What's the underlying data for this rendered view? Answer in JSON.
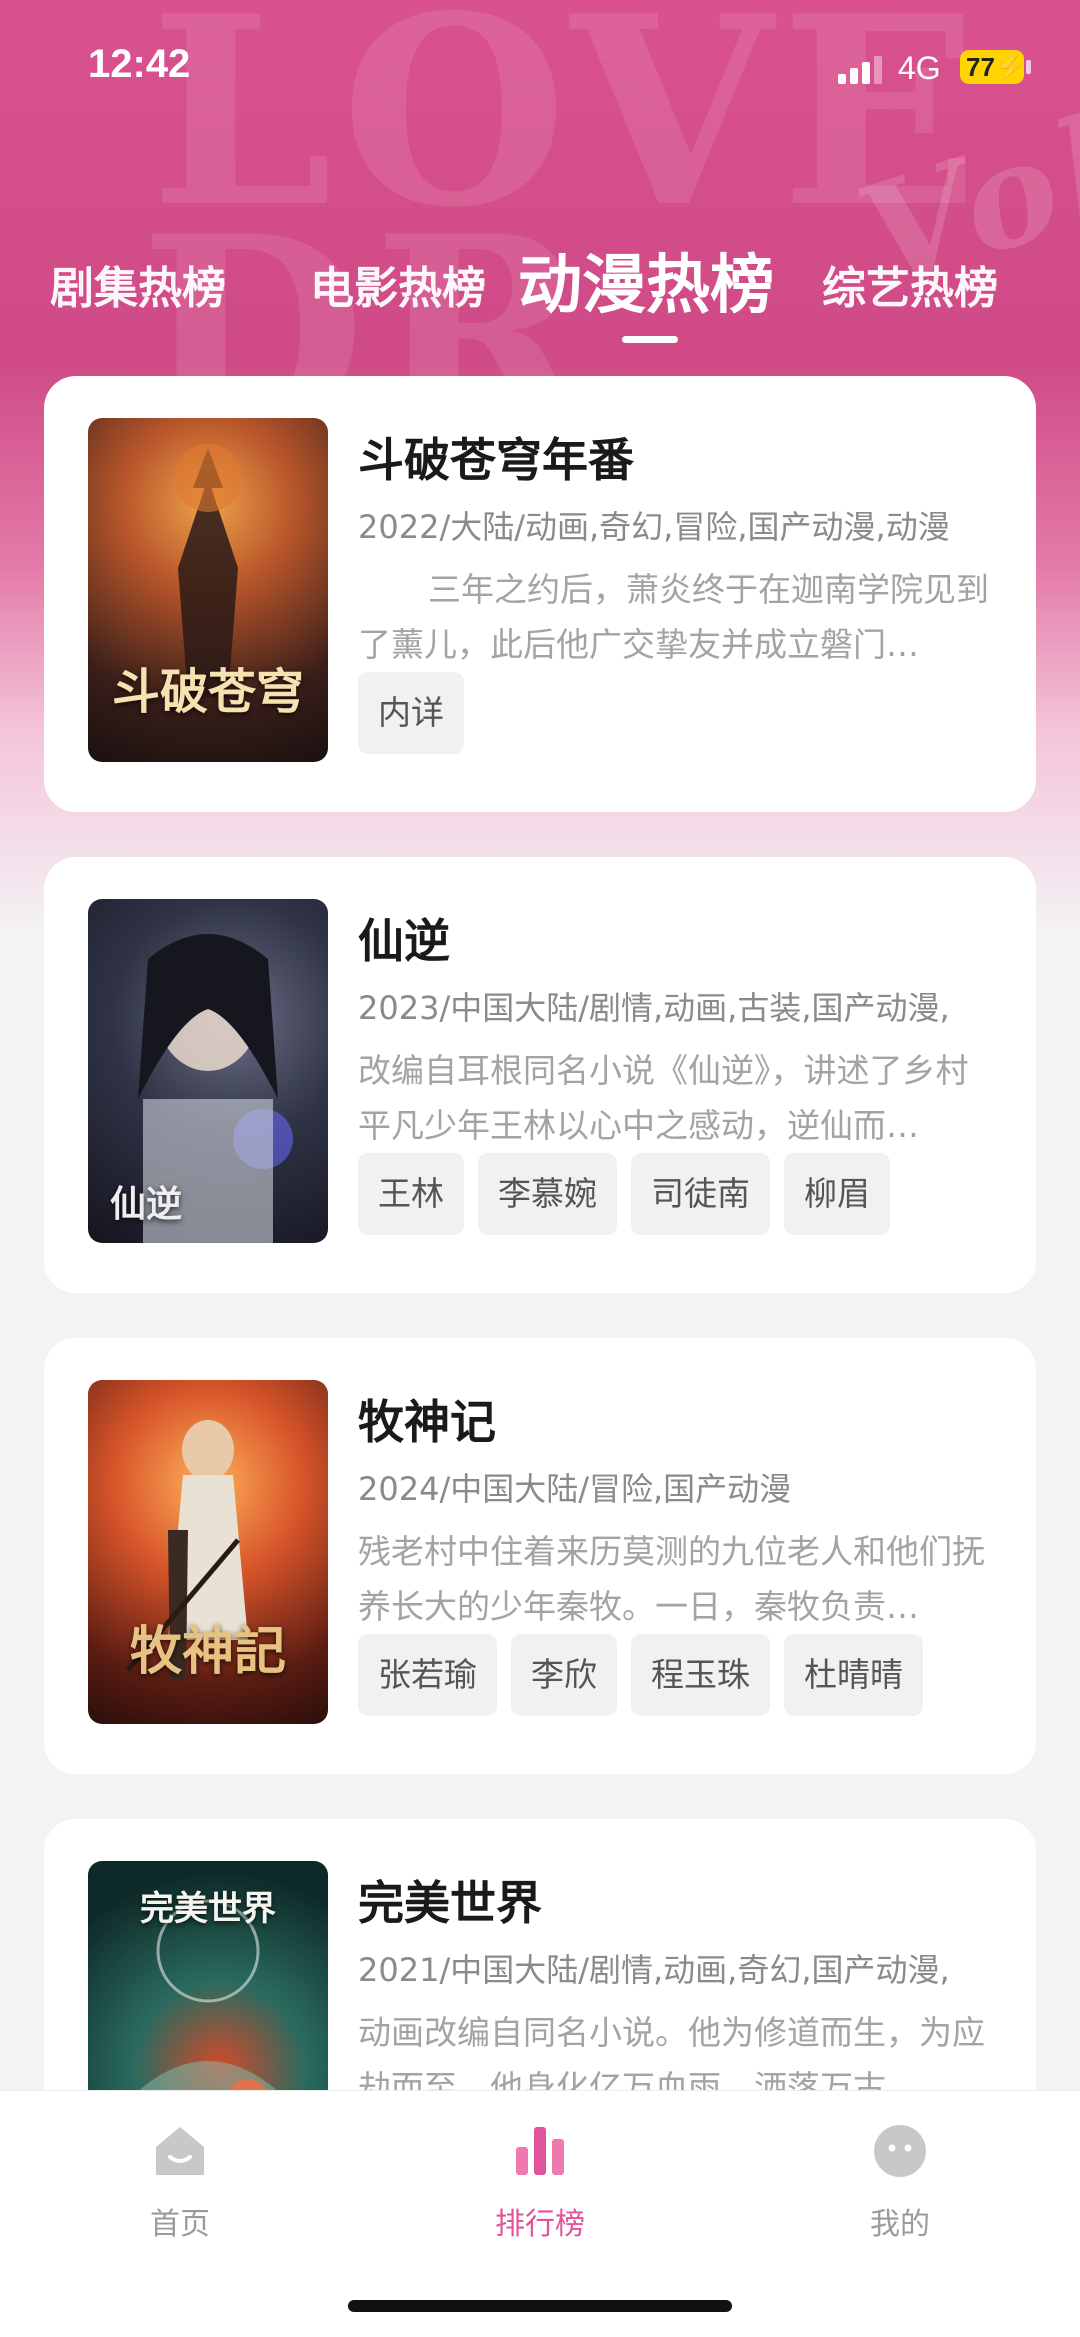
{
  "status_bar": {
    "time": "12:42",
    "network": "4G",
    "battery": "77"
  },
  "tabs": [
    {
      "label": "剧集热榜"
    },
    {
      "label": "电影热榜"
    },
    {
      "label": "动漫热榜",
      "active": true
    },
    {
      "label": "综艺热榜"
    }
  ],
  "items": [
    {
      "title": "斗破苍穹年番",
      "meta": "2022/大陆/动画,奇幻,冒险,国产动漫,动漫",
      "desc": "三年之约后，萧炎终于在迦南学院见到了薰儿，此后他广交挚友并成立磐门…",
      "tags": [
        "内详"
      ],
      "poster_text": "斗破苍穹"
    },
    {
      "title": "仙逆",
      "meta": "2023/中国大陆/剧情,动画,古装,国产动漫,",
      "desc": "改编自耳根同名小说《仙逆》，讲述了乡村平凡少年王林以心中之感动，逆仙而…",
      "tags": [
        "王林",
        "李慕婉",
        "司徒南",
        "柳眉"
      ],
      "poster_text": "仙逆"
    },
    {
      "title": "牧神记",
      "meta": "2024/中国大陆/冒险,国产动漫",
      "desc": "残老村中住着来历莫测的九位老人和他们抚养长大的少年秦牧。一日，秦牧负责…",
      "tags": [
        "张若瑜",
        "李欣",
        "程玉珠",
        "杜晴晴"
      ],
      "poster_text": "牧神記"
    },
    {
      "title": "完美世界",
      "meta": "2021/中国大陆/剧情,动画,奇幻,国产动漫,",
      "desc": "动画改编自同名小说。他为修道而生，为应劫而至，他身化亿万血雨，洒落万古…",
      "tags": [],
      "poster_text": "完美世界"
    }
  ],
  "bottom_nav": [
    {
      "label": "首页",
      "icon": "home-icon"
    },
    {
      "label": "排行榜",
      "icon": "ranking-icon",
      "active": true
    },
    {
      "label": "我的",
      "icon": "profile-icon"
    }
  ],
  "colors": {
    "accent": "#e0559a",
    "hero": "#d9528f"
  }
}
